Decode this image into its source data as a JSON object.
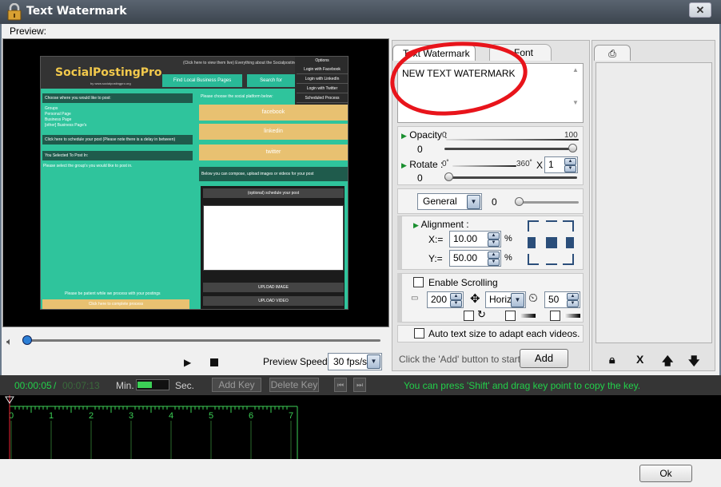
{
  "window": {
    "title": "Text Watermark",
    "close_glyph": "✕"
  },
  "preview": {
    "label": "Preview:",
    "speed_label": "Preview Speed:",
    "speed_value": "30 fps/s"
  },
  "web_preview": {
    "logo": "SocialPostingPro",
    "tagline": "by www.socialpostingpro.org",
    "top_link": "(Click here to view them live) Everything about the Socialposting & Tie",
    "tab_find": "Find Local Business Pages",
    "tab_search": "Search for",
    "menu": [
      "Options",
      "Login with Facebook",
      "Login with LinkedIn",
      "Login with Twitter",
      "Scheduled Process"
    ],
    "left_header": "Choose where you would like to post:",
    "left_items": [
      "Groups",
      "Personal Page",
      "Business Page",
      "[other] Business Page's"
    ],
    "schedule_note": "Click here to schedule your post (Please note there is a delay in between)",
    "selected_note": "You Selected To Post In:",
    "select_prompt": "Please select the group's you would like to post in.",
    "patience": "Please be patient while we process with your postings",
    "process_btn": "Click here to complete process",
    "right_header": "Please choose the social platform below:",
    "platforms": [
      "facebook",
      "linkedin",
      "twitter"
    ],
    "compose_note": "Below you can compose, upload images or videos for your post",
    "optional_note": "(optional) schedule your post",
    "upload_image": "UPLOAD IMAGE",
    "upload_video": "UPLOAD VIDEO"
  },
  "tabs": {
    "text_watermark": "Text Watermark",
    "font": "Font"
  },
  "watermark": {
    "text": "NEW TEXT WATERMARK"
  },
  "opacity": {
    "label": "Opacity :",
    "min": "0",
    "max": "100",
    "value": "0",
    "level": 1.0
  },
  "rotate": {
    "label": "Rotate :",
    "min": "0˚",
    "max": "360˚",
    "x_label": "X",
    "value": "0",
    "spin_value": "1",
    "level": 0.0
  },
  "general": {
    "select": "General",
    "value": "0",
    "level": 0.0
  },
  "alignment": {
    "label": "Alignment :",
    "x_label": "X:=",
    "x_value": "10.00",
    "y_label": "Y:=",
    "y_value": "50.00",
    "unit": "%"
  },
  "scrolling": {
    "label": "Enable Scrolling",
    "distance": "200",
    "direction": "Horiz",
    "speed": "50"
  },
  "auto_size": {
    "label": "Auto text size to adapt each videos."
  },
  "add_hint": "Click the 'Add' button to start ->",
  "add_label": "Add",
  "timeline": {
    "current": "00:00:05",
    "separator": "/",
    "total": "00:07:13",
    "min_label": "Min.",
    "sec_label": "Sec.",
    "add_key": "Add Key",
    "delete_key": "Delete Key",
    "hint": "You can press 'Shift' and drag key point to copy the key.",
    "ticks": [
      "0",
      "1",
      "2",
      "3",
      "4",
      "5",
      "6",
      "7"
    ]
  },
  "ok_label": "Ok",
  "colors": {
    "accent_green": "#22d04a",
    "annotation_red": "#e8141b",
    "slider_blue": "#2c7fd6"
  }
}
